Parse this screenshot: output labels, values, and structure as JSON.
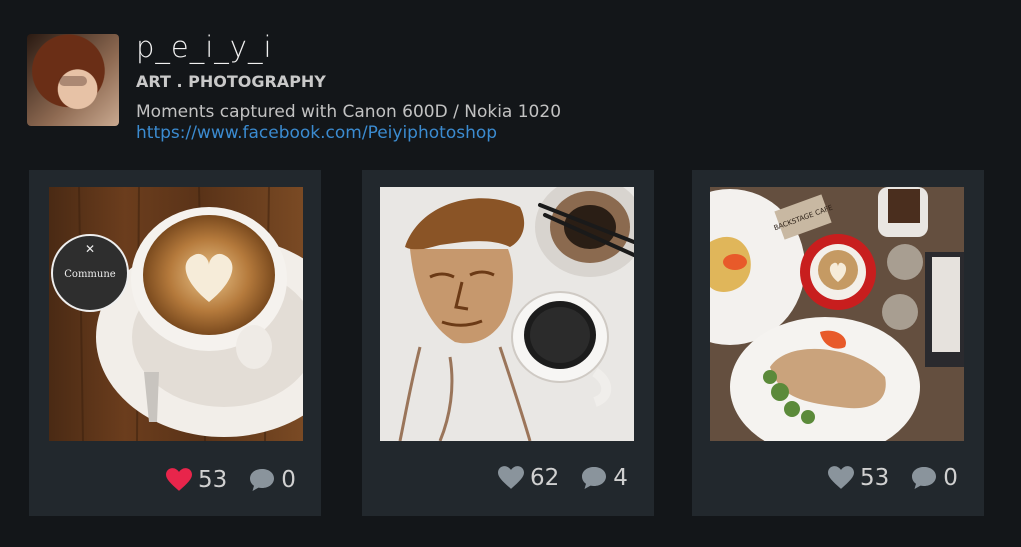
{
  "profile": {
    "username": "p_e_i_y_i",
    "tagline": "ART . PHOTOGRAPHY",
    "bio": "Moments captured with Canon 600D / Nokia 1020",
    "link": "https://www.facebook.com/Peiyiphotoshop"
  },
  "posts": [
    {
      "likes": "53",
      "comments": "0",
      "liked": true,
      "heart_color": "#e8254b",
      "cafe_label": "Commune"
    },
    {
      "likes": "62",
      "comments": "4",
      "liked": false,
      "heart_color": "#8a949c"
    },
    {
      "likes": "53",
      "comments": "0",
      "liked": false,
      "heart_color": "#8a949c",
      "cafe_label": "BACKSTAGE CAFE"
    }
  ],
  "colors": {
    "background": "#131619",
    "card": "#22282d",
    "link": "#3b8bd0",
    "like_active": "#e8254b"
  }
}
